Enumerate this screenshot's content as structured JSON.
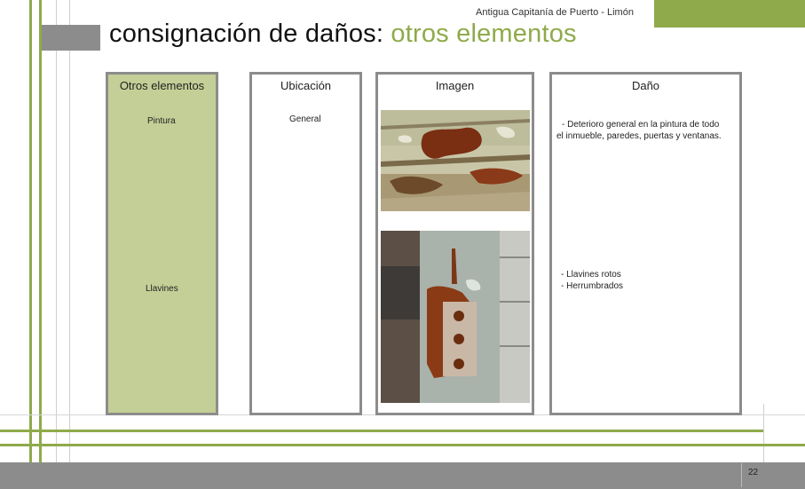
{
  "header": {
    "subtitle": "Antigua Capitanía de Puerto - Limón"
  },
  "title": {
    "main": "consignación de daños:",
    "accent": "otros elementos"
  },
  "columns": {
    "elements": {
      "label": "Otros elementos"
    },
    "location": {
      "label": "Ubicación"
    },
    "image": {
      "label": "Imagen"
    },
    "damage": {
      "label": "Daño"
    }
  },
  "rows": [
    {
      "element": "Pintura",
      "location": "General",
      "image": "peeling-paint-photo",
      "damage": [
        "- Deterioro general en la pintura de todo",
        "el inmueble, paredes, puertas y ventanas."
      ]
    },
    {
      "element": "Llavines",
      "location": "",
      "image": "rusted-lock-photo",
      "damage": [
        "- Llavines rotos",
        "- Herrumbrados"
      ]
    }
  ],
  "footer": {
    "page_number": "22"
  },
  "colors": {
    "accent_green": "#8faa4a",
    "column_green": "#c3cf96",
    "border_gray": "#8c8c8c"
  }
}
